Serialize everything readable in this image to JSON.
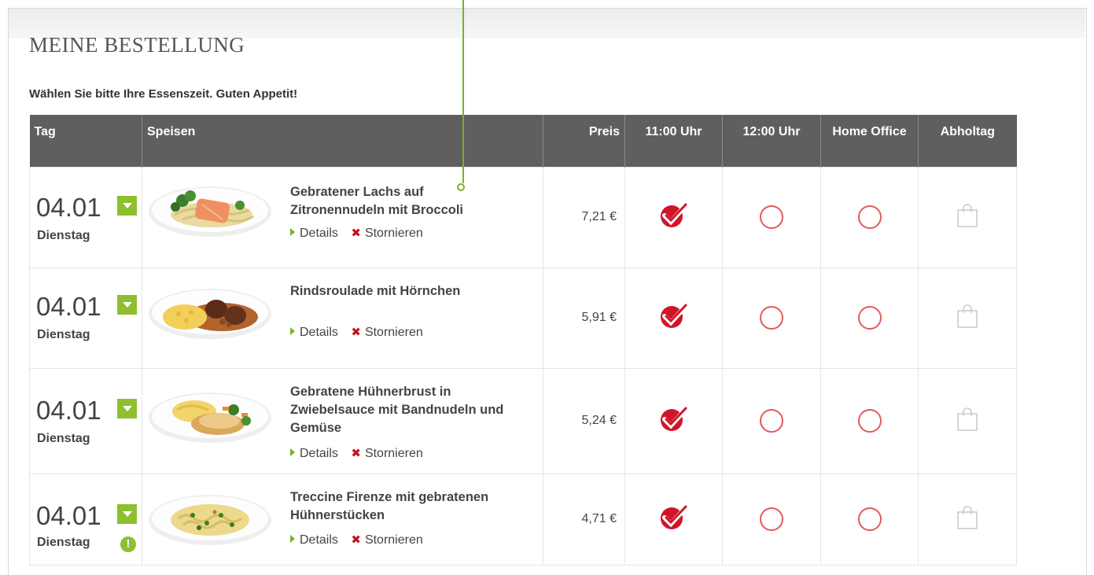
{
  "page": {
    "title": "MEINE BESTELLUNG",
    "subtitle": "Wählen Sie bitte Ihre Essenszeit. Guten Appetit!"
  },
  "table": {
    "headers": {
      "tag": "Tag",
      "speisen": "Speisen",
      "preis": "Preis",
      "slot1": "11:00 Uhr",
      "slot2": "12:00 Uhr",
      "home": "Home Office",
      "abholtag": "Abholtag"
    },
    "actions": {
      "details": "Details",
      "cancel": "Stornieren"
    },
    "rows": [
      {
        "date": "04.01",
        "weekday": "Dienstag",
        "dish": "Gebratener Lachs auf Zitronennudeln mit Broccoli",
        "price": "7,21 €",
        "selected_slot": "11:00 Uhr",
        "warning": false,
        "dish_icon": "salmon-plate"
      },
      {
        "date": "04.01",
        "weekday": "Dienstag",
        "dish": "Rindsroulade mit Hörnchen",
        "price": "5,91 €",
        "selected_slot": "11:00 Uhr",
        "warning": false,
        "dish_icon": "roulade-plate"
      },
      {
        "date": "04.01",
        "weekday": "Dienstag",
        "dish": "Gebratene Hühnerbrust in Zwiebelsauce mit Bandnudeln und Gemüse",
        "price": "5,24 €",
        "selected_slot": "11:00 Uhr",
        "warning": false,
        "dish_icon": "chicken-plate"
      },
      {
        "date": "04.01",
        "weekday": "Dienstag",
        "dish": "Treccine Firenze mit gebratenen Hühnerstücken",
        "price": "4,71 €",
        "selected_slot": "11:00 Uhr",
        "warning": true,
        "dish_icon": "pasta-plate"
      }
    ]
  },
  "colors": {
    "accent_green": "#8dbf2f",
    "header_gray": "#5f5f5f",
    "cancel_red": "#c5141b",
    "checkmark_red": "#d0152a",
    "radio_red": "#e35a5a"
  }
}
